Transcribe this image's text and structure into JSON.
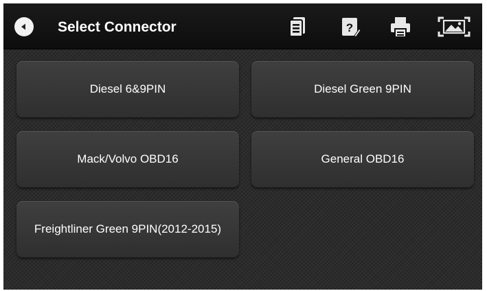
{
  "header": {
    "title": "Select Connector",
    "icons": [
      "back-icon",
      "report-icon",
      "help-icon",
      "print-icon",
      "screenshot-icon"
    ]
  },
  "connectors": [
    {
      "label": "Diesel 6&9PIN"
    },
    {
      "label": "Diesel Green 9PIN"
    },
    {
      "label": "Mack/Volvo OBD16"
    },
    {
      "label": "General OBD16"
    },
    {
      "label": "Freightliner Green 9PIN(2012-2015)"
    }
  ],
  "colors": {
    "background": "#2c2c2c",
    "topbar": "#111111",
    "button": "#3a3a3a",
    "text": "#ffffff"
  }
}
